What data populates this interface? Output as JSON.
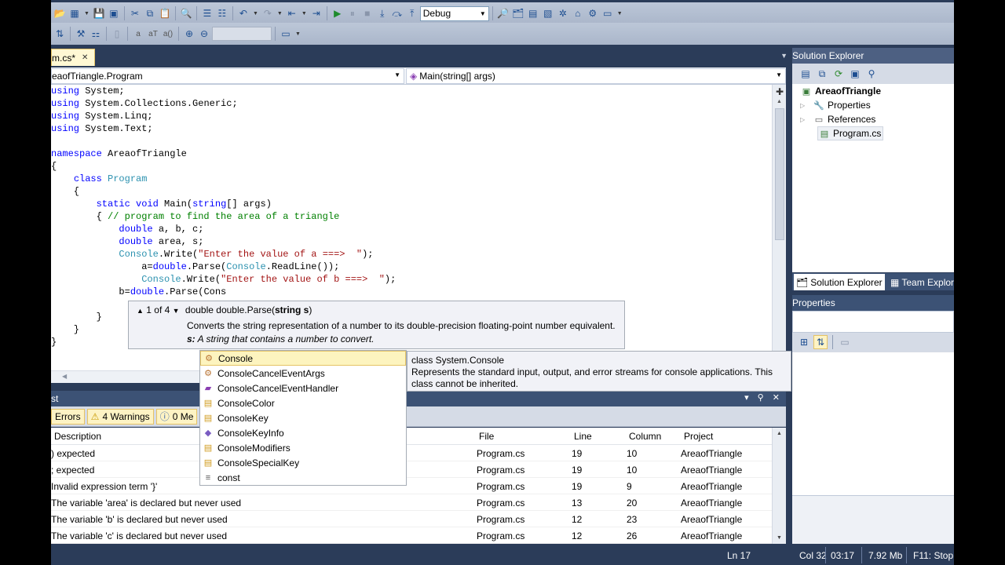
{
  "toolbar": {
    "config_select": "Debug"
  },
  "editor": {
    "tab_label": "m.cs*",
    "tab_close": "✕",
    "nav_class": "eaofTriangle.Program",
    "nav_member": "Main(string[] args)",
    "code_lines": [
      "using System;",
      "using System.Collections.Generic;",
      "using System.Linq;",
      "using System.Text;",
      "",
      "namespace AreaofTriangle",
      "{",
      "    class Program",
      "    {",
      "        static void Main(string[] args)",
      "        { // program to find the area of a triangle",
      "            double a, b, c;",
      "            double area, s;",
      "            Console.Write(\"Enter the value of a ===>  \");",
      "                a=double.Parse(Console.ReadLine());",
      "                Console.Write(\"Enter the value of b ===>  \");",
      "            b=double.Parse(Cons",
      "",
      "        }",
      "    }",
      "}"
    ]
  },
  "signature_tip": {
    "counter": "1 of 4",
    "signature_prefix": "double double.Parse(",
    "signature_param": "string s",
    "signature_suffix": ")",
    "description": "Converts the string representation of a number to its double-precision floating-point number equivalent.",
    "param_name": "s:",
    "param_desc": "A string that contains a number to convert."
  },
  "completion": {
    "items": [
      {
        "label": "Console",
        "icon": "class-icon"
      },
      {
        "label": "ConsoleCancelEventArgs",
        "icon": "class-icon"
      },
      {
        "label": "ConsoleCancelEventHandler",
        "icon": "delegate-icon"
      },
      {
        "label": "ConsoleColor",
        "icon": "enum-icon"
      },
      {
        "label": "ConsoleKey",
        "icon": "enum-icon"
      },
      {
        "label": "ConsoleKeyInfo",
        "icon": "struct-icon"
      },
      {
        "label": "ConsoleModifiers",
        "icon": "enum-icon"
      },
      {
        "label": "ConsoleSpecialKey",
        "icon": "enum-icon"
      },
      {
        "label": "const",
        "icon": "keyword-icon"
      }
    ],
    "desc_title": "class System.Console",
    "desc_body": "Represents the standard input, output, and error streams for console applications. This class cannot be inherited."
  },
  "error_list": {
    "title": "st",
    "errors_btn": "Errors",
    "warnings_btn": "4 Warnings",
    "messages_btn": "0 Me",
    "columns": {
      "description": "Description",
      "file": "File",
      "line": "Line",
      "column": "Column",
      "project": "Project"
    },
    "rows": [
      {
        "description": ") expected",
        "file": "Program.cs",
        "line": "19",
        "column": "10",
        "project": "AreaofTriangle"
      },
      {
        "description": "; expected",
        "file": "Program.cs",
        "line": "19",
        "column": "10",
        "project": "AreaofTriangle"
      },
      {
        "description": "Invalid expression term '}'",
        "file": "Program.cs",
        "line": "19",
        "column": "9",
        "project": "AreaofTriangle"
      },
      {
        "description": "The variable 'area' is declared but never used",
        "file": "Program.cs",
        "line": "13",
        "column": "20",
        "project": "AreaofTriangle"
      },
      {
        "description": "The variable 'b' is declared but never used",
        "file": "Program.cs",
        "line": "12",
        "column": "23",
        "project": "AreaofTriangle"
      },
      {
        "description": "The variable 'c' is declared but never used",
        "file": "Program.cs",
        "line": "12",
        "column": "26",
        "project": "AreaofTriangle"
      }
    ]
  },
  "solution_explorer": {
    "title": "Solution Explorer",
    "project": "AreaofTriangle",
    "items": [
      "Properties",
      "References",
      "Program.cs"
    ],
    "tab_solution": "Solution Explorer",
    "tab_team": "Team Explor"
  },
  "properties": {
    "title": "Properties"
  },
  "status_bar": {
    "line": "Ln 17",
    "col": "Col 32",
    "time": "03:17",
    "memory": "7.92 Mb",
    "stop": "F11: Stop"
  }
}
